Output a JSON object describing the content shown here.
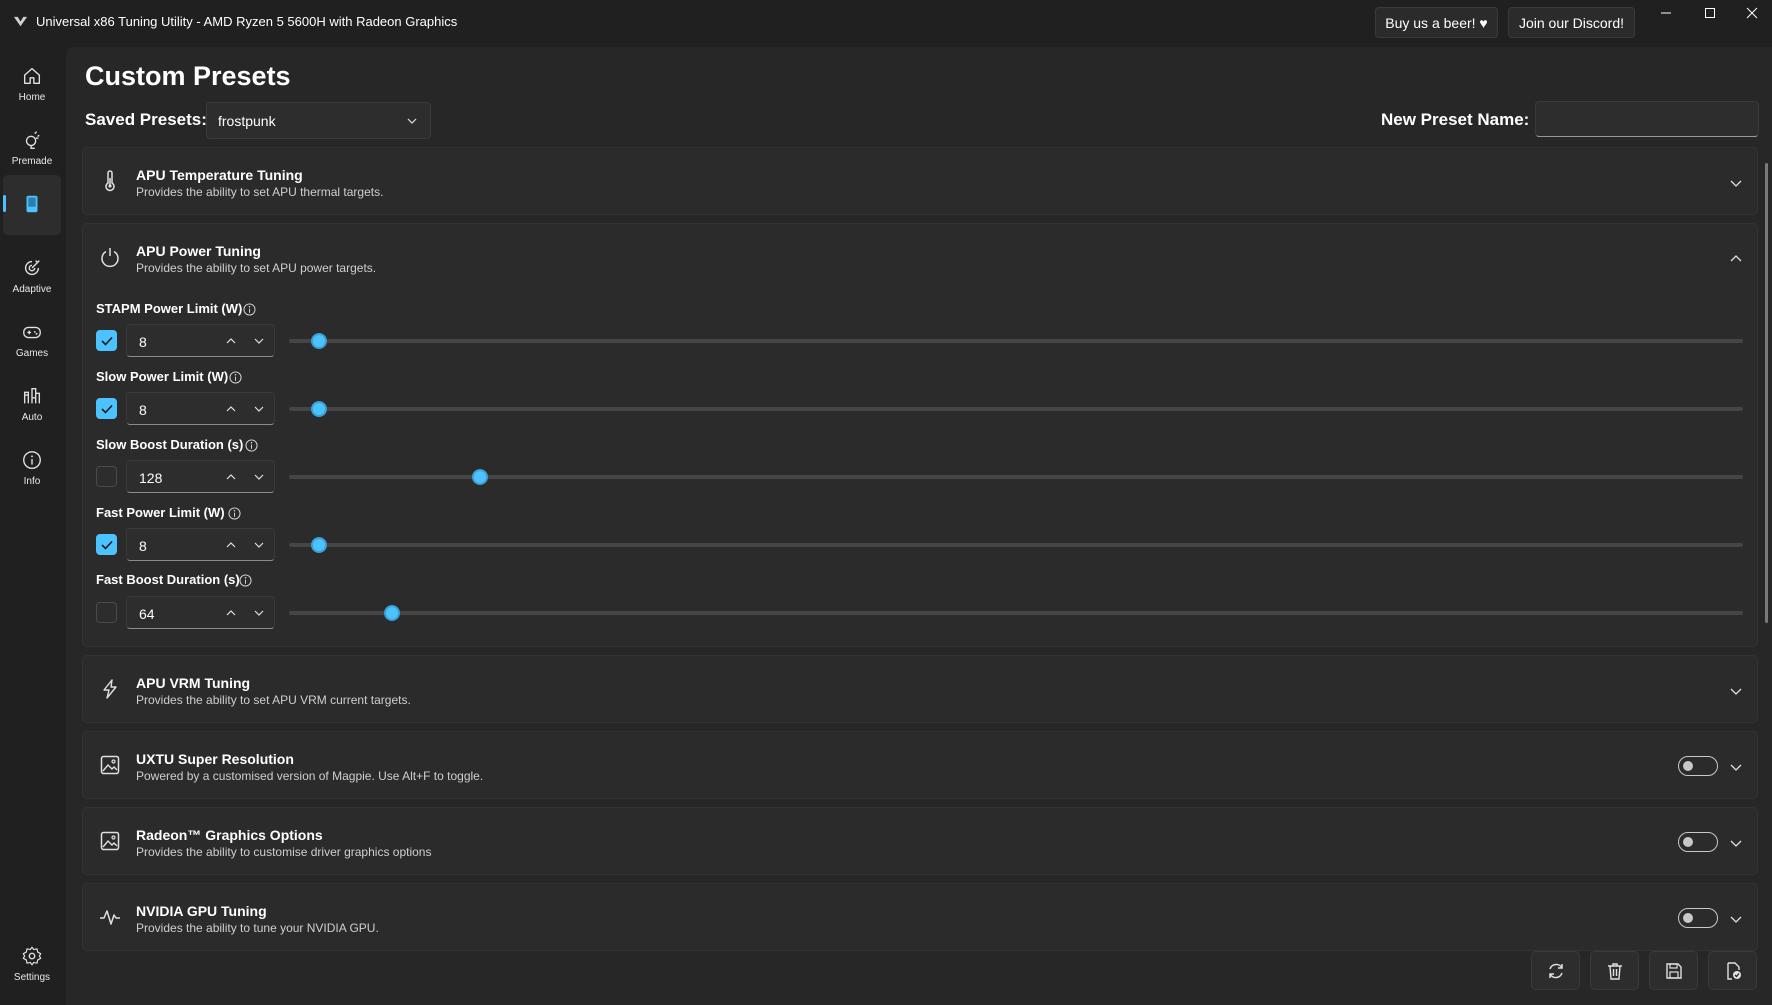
{
  "window": {
    "title": "Universal x86 Tuning Utility - AMD Ryzen 5 5600H with Radeon Graphics",
    "buy_beer": "Buy us a beer! ♥",
    "discord": "Join our Discord!",
    "minimize": "—",
    "maximize": "☐",
    "close": "✕"
  },
  "sidebar": {
    "items": [
      {
        "label": "Home",
        "icon": "home-icon"
      },
      {
        "label": "Premade",
        "icon": "premade-icon"
      },
      {
        "label": "",
        "icon": "custom-presets-icon",
        "active": true
      },
      {
        "label": "Adaptive",
        "icon": "adaptive-icon"
      },
      {
        "label": "Games",
        "icon": "gamepad-icon"
      },
      {
        "label": "Auto",
        "icon": "auto-icon"
      },
      {
        "label": "Info",
        "icon": "info-icon"
      }
    ],
    "settings_label": "Settings"
  },
  "page": {
    "title": "Custom Presets",
    "saved_presets_label": "Saved Presets:",
    "saved_preset_value": "frostpunk",
    "new_preset_label": "New Preset Name:",
    "new_preset_value": ""
  },
  "cards": {
    "temperature": {
      "title": "APU Temperature Tuning",
      "subtitle": "Provides the ability to set APU thermal targets.",
      "expanded": false
    },
    "power": {
      "title": "APU Power Tuning",
      "subtitle": "Provides the ability to set APU power targets.",
      "expanded": true
    },
    "vrm": {
      "title": "APU VRM Tuning",
      "subtitle": "Provides the ability to set APU VRM current targets.",
      "expanded": false
    },
    "super_res": {
      "title": "UXTU Super Resolution",
      "subtitle": "Powered by a customised version of Magpie. Use Alt+F to toggle.",
      "toggle": false
    },
    "radeon": {
      "title": "Radeon™ Graphics Options",
      "subtitle": "Provides the ability to customise driver graphics options",
      "toggle": false
    },
    "nvidia": {
      "title": "NVIDIA GPU Tuning",
      "subtitle": "Provides the ability to tune your NVIDIA GPU.",
      "toggle": false
    }
  },
  "power_params": [
    {
      "label": "STAPM Power Limit (W)",
      "enabled": true,
      "value": "8",
      "slider_fraction": 0.015
    },
    {
      "label": "Slow Power Limit (W)",
      "enabled": true,
      "value": "8",
      "slider_fraction": 0.015
    },
    {
      "label": "Slow Boost Duration (s)",
      "enabled": false,
      "value": "128",
      "slider_fraction": 0.126
    },
    {
      "label": "Fast Power Limit (W)",
      "enabled": true,
      "value": "8",
      "slider_fraction": 0.015
    },
    {
      "label": "Fast Boost Duration (s)",
      "enabled": false,
      "value": "64",
      "slider_fraction": 0.065
    }
  ],
  "actions": [
    "reload-icon",
    "delete-icon",
    "save-icon",
    "apply-icon"
  ],
  "colors": {
    "accent": "#4cc2ff",
    "background": "#202020",
    "panel": "#272727",
    "card": "#2b2b2b"
  }
}
